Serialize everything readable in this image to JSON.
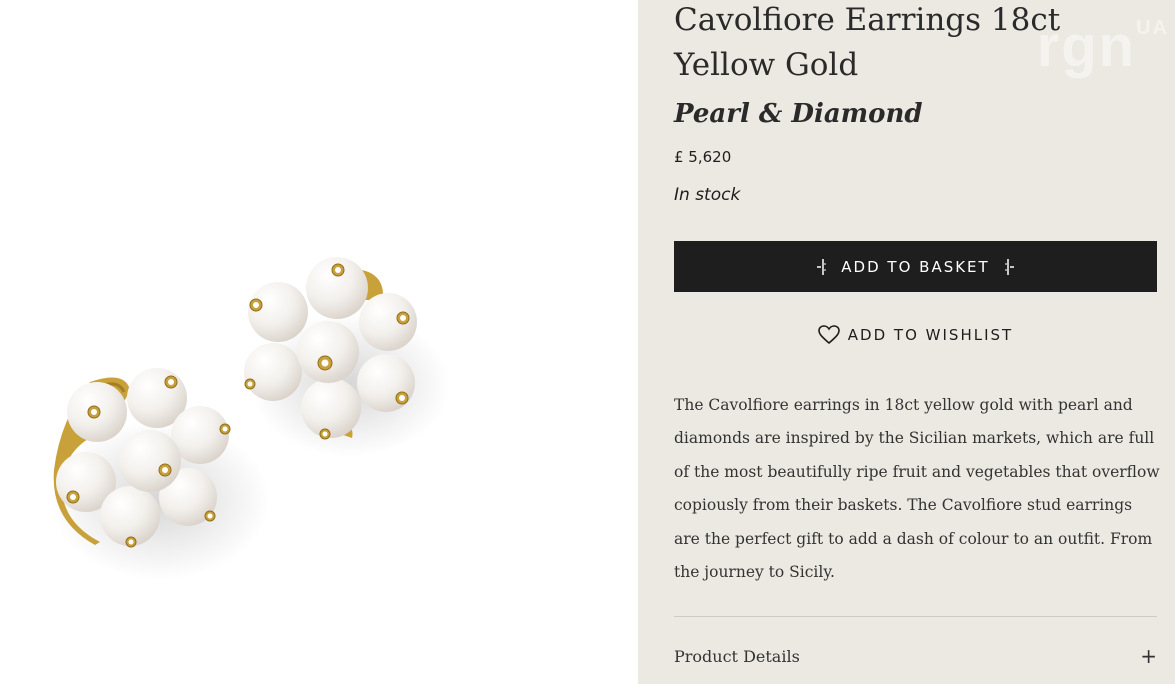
{
  "product": {
    "title": "Cavolfiore Earrings 18ct Yellow Gold",
    "subtitle": "Pearl & Diamond",
    "price": "£ 5,620",
    "stock_status": "In stock",
    "description": "The Cavolfiore earrings in 18ct yellow gold with pearl and diamonds are inspired by the Sicilian markets, which are full of the most beautifully ripe fruit and vegetables that overflow copiously from their baskets. The Cavolfiore stud earrings are the perfect gift to add a dash of colour to an outfit. From the journey to Sicily."
  },
  "actions": {
    "add_to_basket": "ADD TO BASKET",
    "add_to_wishlist": "ADD TO WISHLIST"
  },
  "accordion": {
    "product_details_label": "Product Details",
    "toggle_symbol": "+"
  },
  "image": {
    "subject": "pearl-cluster-earrings",
    "gold_color": "#c9a13b",
    "pearl_color": "#f4f1ed"
  },
  "watermark": {
    "text": "rgn",
    "suffix": "UA"
  },
  "colors": {
    "panel_background": "#ece9e2",
    "button_background": "#1e1e1e",
    "text": "#2a2a2a"
  }
}
